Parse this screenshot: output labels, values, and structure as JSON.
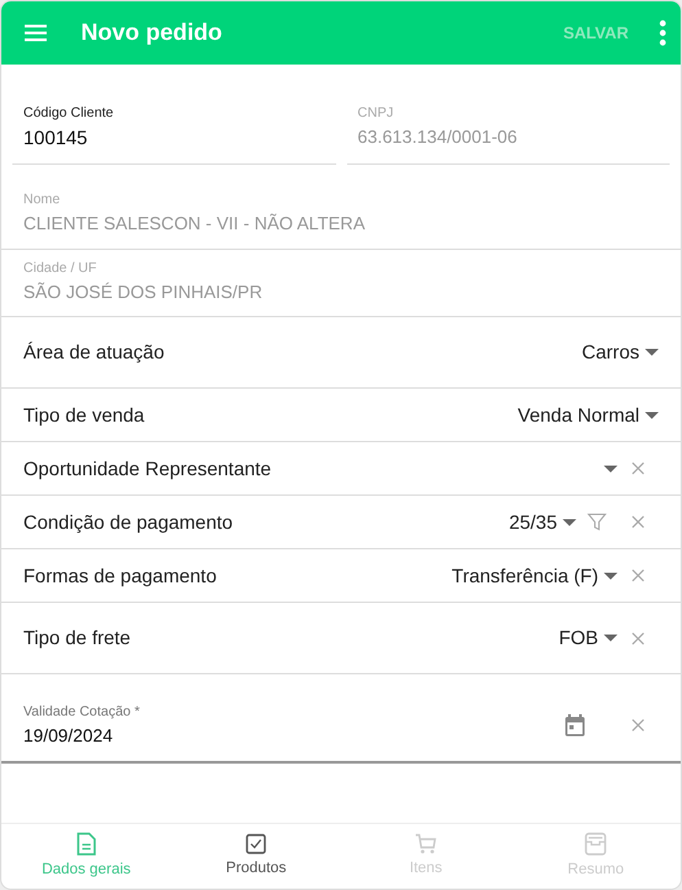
{
  "header": {
    "title": "Novo pedido",
    "save_label": "SALVAR",
    "save_disabled": true
  },
  "client_fields": [
    {
      "kind": "editable",
      "label": "Código Cliente",
      "value": "100145"
    },
    {
      "kind": "readonly",
      "label": "CNPJ",
      "value": "63.613.134/0001-06"
    }
  ],
  "info_fields": [
    {
      "label": "Nome",
      "value": "CLIENTE SALESCON - VII - NÃO ALTERA"
    },
    {
      "label": "Cidade / UF",
      "value": "SÃO JOSÉ DOS PINHAIS/PR"
    }
  ],
  "selects": [
    {
      "label": "Área de atuação",
      "value": "Carros",
      "filter": false,
      "clearable": false
    },
    {
      "label": "Tipo de venda",
      "value": "Venda Normal",
      "filter": false,
      "clearable": false
    },
    {
      "label": "Oportunidade Representante",
      "filter": false,
      "clearable": true
    },
    {
      "label": "Condição de pagamento",
      "value": "25/35",
      "filter": true,
      "clearable": true
    },
    {
      "label": "Formas de pagamento",
      "value": "Transferência (F)",
      "filter": false,
      "clearable": true
    },
    {
      "label": "Tipo de frete",
      "value": "FOB",
      "filter": false,
      "clearable": true
    }
  ],
  "date_field": {
    "label": "Validade Cotação *",
    "value": "19/09/2024"
  },
  "tabs": [
    {
      "kind": "document",
      "label": "Dados gerais",
      "selected": true,
      "disabled": false
    },
    {
      "kind": "checkbox",
      "label": "Produtos",
      "selected": false,
      "disabled": false
    },
    {
      "kind": "cart",
      "label": "Itens",
      "selected": false,
      "disabled": true
    },
    {
      "kind": "inbox",
      "label": "Resumo",
      "selected": false,
      "disabled": true
    }
  ]
}
